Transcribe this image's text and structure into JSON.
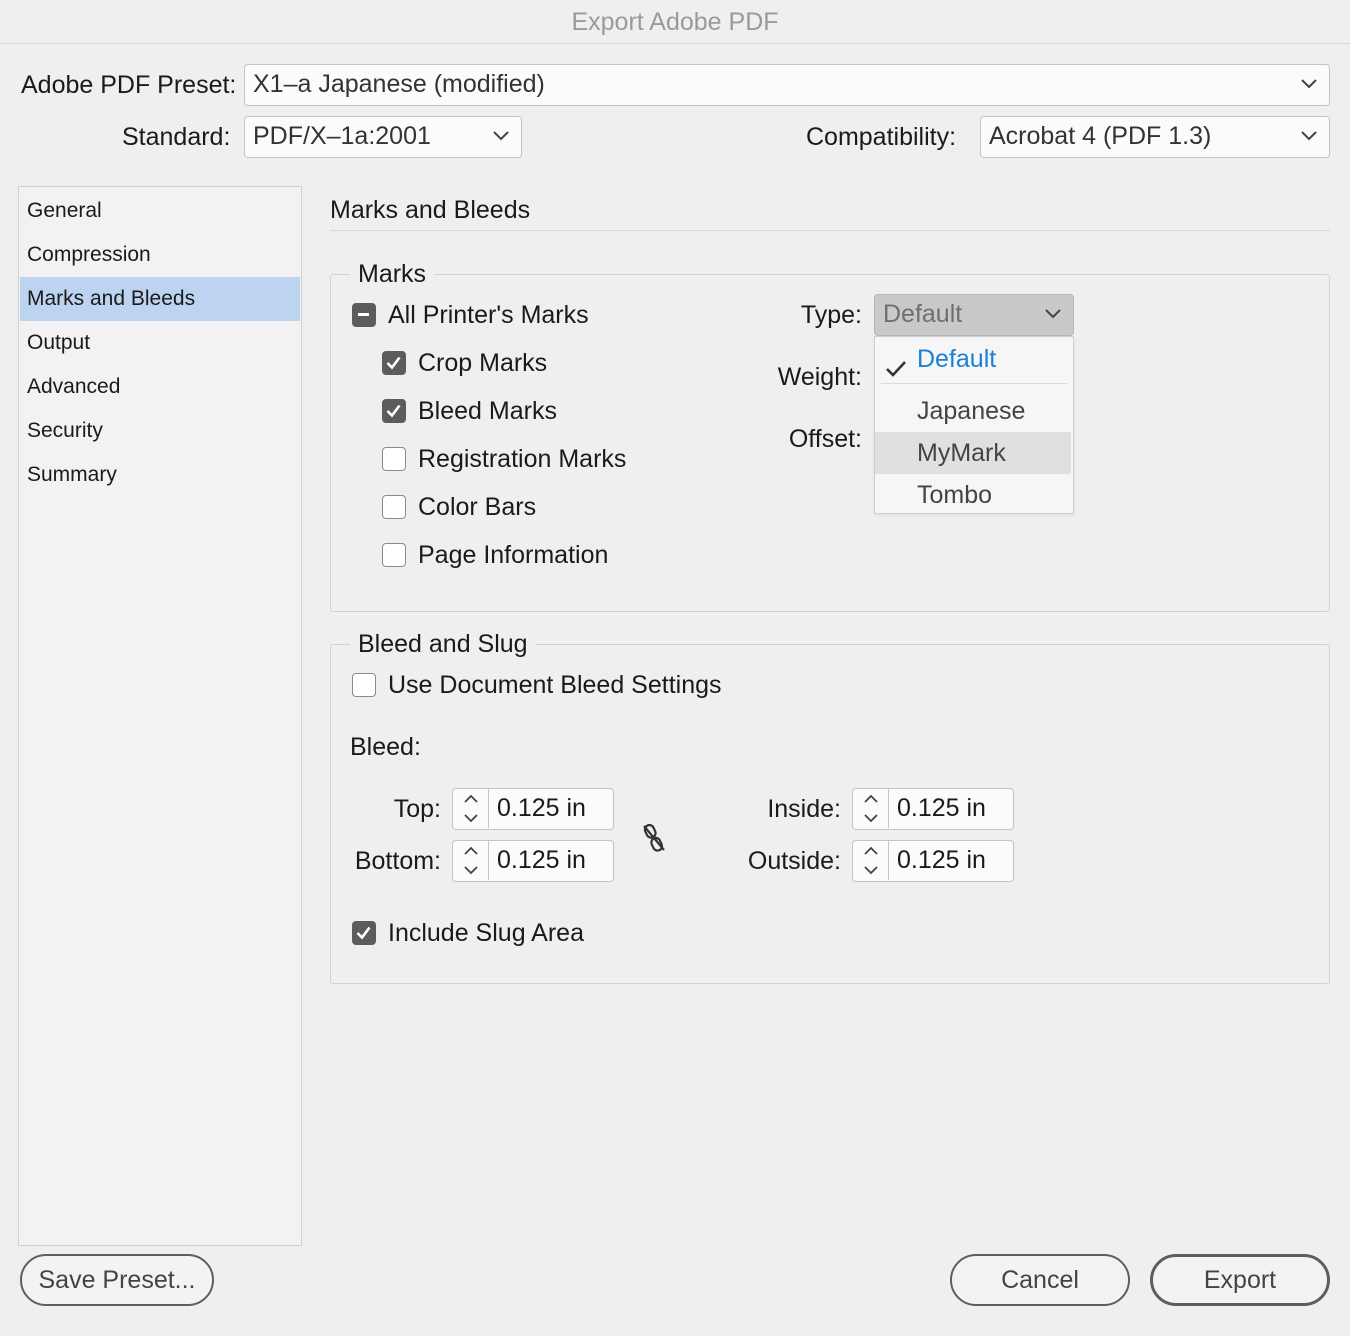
{
  "window": {
    "title": "Export Adobe PDF"
  },
  "preset": {
    "label": "Adobe PDF Preset:",
    "value": "X1–a Japanese (modified)"
  },
  "standard": {
    "label": "Standard:",
    "value": "PDF/X–1a:2001"
  },
  "compatibility": {
    "label": "Compatibility:",
    "value": "Acrobat 4 (PDF 1.3)"
  },
  "sidebar": {
    "items": [
      {
        "label": "General"
      },
      {
        "label": "Compression"
      },
      {
        "label": "Marks and Bleeds"
      },
      {
        "label": "Output"
      },
      {
        "label": "Advanced"
      },
      {
        "label": "Security"
      },
      {
        "label": "Summary"
      }
    ],
    "selected": "Marks and Bleeds"
  },
  "panel": {
    "title": "Marks and Bleeds"
  },
  "marks": {
    "legend": "Marks",
    "all_printers_marks": {
      "label": "All Printer's Marks",
      "state": "mixed"
    },
    "items": [
      {
        "label": "Crop Marks",
        "checked": true
      },
      {
        "label": "Bleed Marks",
        "checked": true
      },
      {
        "label": "Registration Marks",
        "checked": false
      },
      {
        "label": "Color Bars",
        "checked": false
      },
      {
        "label": "Page Information",
        "checked": false
      }
    ],
    "type_label": "Type:",
    "type_value": "Default",
    "weight_label": "Weight:",
    "offset_label": "Offset:",
    "type_menu": {
      "options": [
        "Default",
        "Japanese",
        "MyMark",
        "Tombo"
      ],
      "selected": "Default",
      "highlighted": "MyMark"
    }
  },
  "bleed_slug": {
    "legend": "Bleed and Slug",
    "use_document": {
      "label": "Use Document Bleed Settings",
      "checked": false
    },
    "bleed_label": "Bleed:",
    "top": {
      "label": "Top:",
      "value": "0.125 in"
    },
    "bottom": {
      "label": "Bottom:",
      "value": "0.125 in"
    },
    "inside": {
      "label": "Inside:",
      "value": "0.125 in"
    },
    "outside": {
      "label": "Outside:",
      "value": "0.125 in"
    },
    "include_slug": {
      "label": "Include Slug Area",
      "checked": true
    },
    "link_icon": "broken-chain-icon"
  },
  "buttons": {
    "save_preset": "Save Preset...",
    "cancel": "Cancel",
    "export": "Export"
  },
  "colors": {
    "sidebar_selected": "#bcd4ef",
    "menu_selected_text": "#1a7fd6",
    "checkbox_checked": "#5c5c5c"
  }
}
